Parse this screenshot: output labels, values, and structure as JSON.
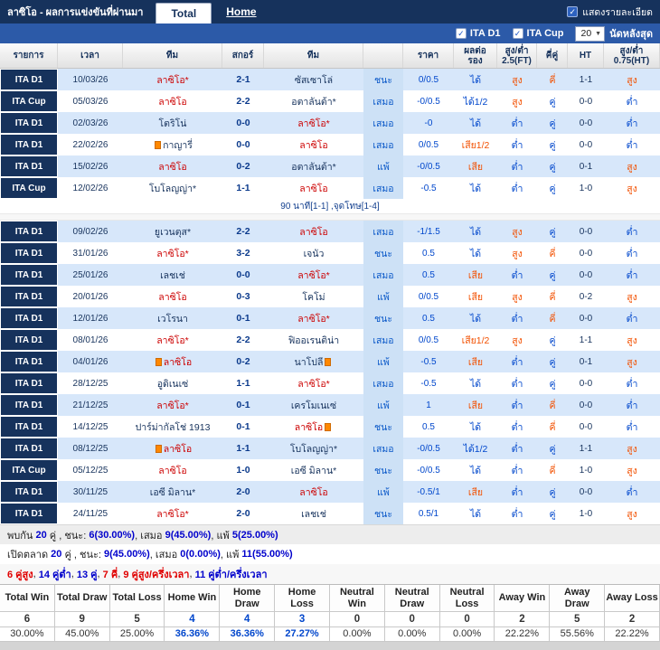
{
  "header": {
    "title": "ลาซิโอ - ผลการแข่งขันที่ผ่านมา",
    "tabs": [
      {
        "label": "Total",
        "active": true
      },
      {
        "label": "Home",
        "active": false
      }
    ],
    "details_label": "แสดงรายละเอียด"
  },
  "filters": {
    "leagues": [
      {
        "label": "ITA D1",
        "checked": true
      },
      {
        "label": "ITA Cup",
        "checked": true
      }
    ],
    "count_value": "20",
    "count_suffix": "นัดหลังสุด"
  },
  "colors": {
    "navy": "#16325c",
    "bar_blue": "#2c5aa8",
    "row_shade": "#d7e7fa",
    "lazio_red": "#cc0000",
    "value_blue": "#0047cc",
    "value_orange": "#f25000"
  },
  "table": {
    "headers": [
      "รายการ",
      "เวลา",
      "ทีม",
      "สกอร์",
      "ทีม",
      "",
      "ราคา",
      "ผลต่อ\nรอง",
      "สูง/ต่ำ\n2.5(FT)",
      "คี่คู่",
      "HT",
      "สูง/ต่ำ\n0.75(HT)"
    ],
    "rows": [
      {
        "league": "ITA D1",
        "date": "10/03/26",
        "home": "ลาซิโอ*",
        "home_lazio": true,
        "score": "2-1",
        "away": "ซัสเซาโล่",
        "result": "ชนะ",
        "price": "0/0.5",
        "handicap_result": "ได้",
        "over_under": "สูง",
        "odd_even": "คี่",
        "ht": "1-1",
        "ht_over_under": "สูง"
      },
      {
        "league": "ITA Cup",
        "date": "05/03/26",
        "home": "ลาซิโอ",
        "home_lazio": true,
        "score": "2-2",
        "away": "อตาลันต้า*",
        "result": "เสมอ",
        "price": "-0/0.5",
        "handicap_result": "ได้1/2",
        "over_under": "สูง",
        "odd_even": "คู่",
        "ht": "0-0",
        "ht_over_under": "ต่ำ"
      },
      {
        "league": "ITA D1",
        "date": "02/03/26",
        "home": "โตริโน่",
        "score": "0-0",
        "away": "ลาซิโอ*",
        "away_lazio": true,
        "result": "เสมอ",
        "price": "-0",
        "handicap_result": "ได้",
        "over_under": "ต่ำ",
        "odd_even": "คู่",
        "ht": "0-0",
        "ht_over_under": "ต่ำ"
      },
      {
        "league": "ITA D1",
        "date": "22/02/26",
        "home": "กาญารี่",
        "home_card": "before",
        "score": "0-0",
        "away": "ลาซิโอ",
        "away_lazio": true,
        "result": "เสมอ",
        "price": "0/0.5",
        "handicap_result": "เสีย1/2",
        "over_under": "ต่ำ",
        "odd_even": "คู่",
        "ht": "0-0",
        "ht_over_under": "ต่ำ"
      },
      {
        "league": "ITA D1",
        "date": "15/02/26",
        "home": "ลาซิโอ",
        "home_lazio": true,
        "score": "0-2",
        "away": "อตาลันต้า*",
        "result": "แพ้",
        "price": "-0/0.5",
        "handicap_result": "เสีย",
        "over_under": "ต่ำ",
        "odd_even": "คู่",
        "ht": "0-1",
        "ht_over_under": "สูง"
      },
      {
        "league": "ITA Cup",
        "date": "12/02/26",
        "home": "โบโลญญ่า*",
        "score": "1-1",
        "away": "ลาซิโอ",
        "away_lazio": true,
        "result": "เสมอ",
        "price": "-0.5",
        "handicap_result": "ได้",
        "over_under": "ต่ำ",
        "odd_even": "คู่",
        "ht": "1-0",
        "ht_over_under": "สูง",
        "note": "90 นาที[1-1] ,จุดโทษ[1-4]",
        "gap_after": true
      },
      {
        "league": "ITA D1",
        "date": "09/02/26",
        "home": "ยูเวนตุส*",
        "score": "2-2",
        "away": "ลาซิโอ",
        "away_lazio": true,
        "result": "เสมอ",
        "price": "-1/1.5",
        "handicap_result": "ได้",
        "over_under": "สูง",
        "odd_even": "คู่",
        "ht": "0-0",
        "ht_over_under": "ต่ำ"
      },
      {
        "league": "ITA D1",
        "date": "31/01/26",
        "home": "ลาซิโอ*",
        "home_lazio": true,
        "score": "3-2",
        "away": "เจนัว",
        "result": "ชนะ",
        "price": "0.5",
        "handicap_result": "ได้",
        "over_under": "สูง",
        "odd_even": "คี่",
        "ht": "0-0",
        "ht_over_under": "ต่ำ"
      },
      {
        "league": "ITA D1",
        "date": "25/01/26",
        "home": "เลชเช่",
        "score": "0-0",
        "away": "ลาซิโอ*",
        "away_lazio": true,
        "result": "เสมอ",
        "price": "0.5",
        "handicap_result": "เสีย",
        "over_under": "ต่ำ",
        "odd_even": "คู่",
        "ht": "0-0",
        "ht_over_under": "ต่ำ"
      },
      {
        "league": "ITA D1",
        "date": "20/01/26",
        "home": "ลาซิโอ",
        "home_lazio": true,
        "score": "0-3",
        "away": "โคโม่",
        "result": "แพ้",
        "price": "0/0.5",
        "handicap_result": "เสีย",
        "over_under": "สูง",
        "odd_even": "คี่",
        "ht": "0-2",
        "ht_over_under": "สูง"
      },
      {
        "league": "ITA D1",
        "date": "12/01/26",
        "home": "เวโรนา",
        "score": "0-1",
        "away": "ลาซิโอ*",
        "away_lazio": true,
        "result": "ชนะ",
        "price": "0.5",
        "handicap_result": "ได้",
        "over_under": "ต่ำ",
        "odd_even": "คี่",
        "ht": "0-0",
        "ht_over_under": "ต่ำ"
      },
      {
        "league": "ITA D1",
        "date": "08/01/26",
        "home": "ลาซิโอ*",
        "home_lazio": true,
        "score": "2-2",
        "away": "ฟิออเรนติน่า",
        "result": "เสมอ",
        "price": "0/0.5",
        "handicap_result": "เสีย1/2",
        "over_under": "สูง",
        "odd_even": "คู่",
        "ht": "1-1",
        "ht_over_under": "สูง"
      },
      {
        "league": "ITA D1",
        "date": "04/01/26",
        "home": "ลาซิโอ",
        "home_lazio": true,
        "home_card": "before",
        "score": "0-2",
        "away": "นาโปลี",
        "away_card": "after",
        "result": "แพ้",
        "price": "-0.5",
        "handicap_result": "เสีย",
        "over_under": "ต่ำ",
        "odd_even": "คู่",
        "ht": "0-1",
        "ht_over_under": "สูง"
      },
      {
        "league": "ITA D1",
        "date": "28/12/25",
        "home": "อูดิเนเซ่",
        "score": "1-1",
        "away": "ลาซิโอ*",
        "away_lazio": true,
        "result": "เสมอ",
        "price": "-0.5",
        "handicap_result": "ได้",
        "over_under": "ต่ำ",
        "odd_even": "คู่",
        "ht": "0-0",
        "ht_over_under": "ต่ำ"
      },
      {
        "league": "ITA D1",
        "date": "21/12/25",
        "home": "ลาซิโอ*",
        "home_lazio": true,
        "score": "0-1",
        "away": "เครโมเนเซ่",
        "result": "แพ้",
        "price": "1",
        "handicap_result": "เสีย",
        "over_under": "ต่ำ",
        "odd_even": "คี่",
        "ht": "0-0",
        "ht_over_under": "ต่ำ"
      },
      {
        "league": "ITA D1",
        "date": "14/12/25",
        "home": "ปาร์ม่ากัลโช่ 1913",
        "score": "0-1",
        "away": "ลาซิโอ",
        "away_lazio": true,
        "away_card": "after",
        "result": "ชนะ",
        "price": "0.5",
        "handicap_result": "ได้",
        "over_under": "ต่ำ",
        "odd_even": "คี่",
        "ht": "0-0",
        "ht_over_under": "ต่ำ"
      },
      {
        "league": "ITA D1",
        "date": "08/12/25",
        "home": "ลาซิโอ",
        "home_lazio": true,
        "home_card": "before",
        "score": "1-1",
        "away": "โบโลญญ่า*",
        "result": "เสมอ",
        "price": "-0/0.5",
        "handicap_result": "ได้1/2",
        "over_under": "ต่ำ",
        "odd_even": "คู่",
        "ht": "1-1",
        "ht_over_under": "สูง"
      },
      {
        "league": "ITA Cup",
        "date": "05/12/25",
        "home": "ลาซิโอ",
        "home_lazio": true,
        "score": "1-0",
        "away": "เอซี มิลาน*",
        "result": "ชนะ",
        "price": "-0/0.5",
        "handicap_result": "ได้",
        "over_under": "ต่ำ",
        "odd_even": "คี่",
        "ht": "1-0",
        "ht_over_under": "สูง"
      },
      {
        "league": "ITA D1",
        "date": "30/11/25",
        "home": "เอซี มิลาน*",
        "score": "2-0",
        "away": "ลาซิโอ",
        "away_lazio": true,
        "result": "แพ้",
        "price": "-0.5/1",
        "handicap_result": "เสีย",
        "over_under": "ต่ำ",
        "odd_even": "คู่",
        "ht": "0-0",
        "ht_over_under": "ต่ำ"
      },
      {
        "league": "ITA D1",
        "date": "24/11/25",
        "home": "ลาซิโอ*",
        "home_lazio": true,
        "score": "2-0",
        "away": "เลชเช่",
        "result": "ชนะ",
        "price": "0.5/1",
        "handicap_result": "ได้",
        "over_under": "ต่ำ",
        "odd_even": "คู่",
        "ht": "1-0",
        "ht_over_under": "สูง"
      }
    ]
  },
  "summary": {
    "lines": [
      [
        {
          "text": "พบกัน ",
          "color": "black"
        },
        {
          "text": "20",
          "color": "blue"
        },
        {
          "text": " คู่ , ชนะ: ",
          "color": "black"
        },
        {
          "text": "6(30.00%)",
          "color": "blue"
        },
        {
          "text": ", เสมอ ",
          "color": "black"
        },
        {
          "text": "9(45.00%)",
          "color": "blue"
        },
        {
          "text": ", แพ้ ",
          "color": "black"
        },
        {
          "text": "5(25.00%)",
          "color": "blue"
        }
      ],
      [
        {
          "text": "เปิดตลาด ",
          "color": "black"
        },
        {
          "text": "20",
          "color": "blue"
        },
        {
          "text": " คู่ , ชนะ: ",
          "color": "black"
        },
        {
          "text": "9(45.00%)",
          "color": "blue"
        },
        {
          "text": ", เสมอ ",
          "color": "black"
        },
        {
          "text": "0(0.00%)",
          "color": "blue"
        },
        {
          "text": ", แพ้ ",
          "color": "black"
        },
        {
          "text": "11(55.00%)",
          "color": "blue"
        }
      ],
      [
        {
          "text": "6 คู่สูง",
          "color": "red"
        },
        {
          "text": ", ",
          "color": "black"
        },
        {
          "text": "14 คู่ต่ำ",
          "color": "blue"
        },
        {
          "text": ", ",
          "color": "black"
        },
        {
          "text": "13 คู่",
          "color": "blue"
        },
        {
          "text": ", ",
          "color": "black"
        },
        {
          "text": "7 คี่",
          "color": "red"
        },
        {
          "text": ", ",
          "color": "black"
        },
        {
          "text": "9 คู่สูง/ครึ่งเวลา",
          "color": "red"
        },
        {
          "text": ", ",
          "color": "black"
        },
        {
          "text": "11 คู่ต่ำ/ครึ่งเวลา",
          "color": "blue"
        }
      ]
    ]
  },
  "stats": {
    "headers": [
      "Total Win",
      "Total Draw",
      "Total Loss",
      "Home Win",
      "Home Draw",
      "Home Loss",
      "Neutral Win",
      "Neutral Draw",
      "Neutral Loss",
      "Away Win",
      "Away Draw",
      "Away Loss"
    ],
    "values": [
      "6",
      "9",
      "5",
      "4",
      "4",
      "3",
      "0",
      "0",
      "0",
      "2",
      "5",
      "2"
    ],
    "percents": [
      "30.00%",
      "45.00%",
      "25.00%",
      "36.36%",
      "36.36%",
      "27.27%",
      "0.00%",
      "0.00%",
      "0.00%",
      "22.22%",
      "55.56%",
      "22.22%"
    ],
    "highlight_columns": [
      3,
      4,
      5
    ]
  }
}
